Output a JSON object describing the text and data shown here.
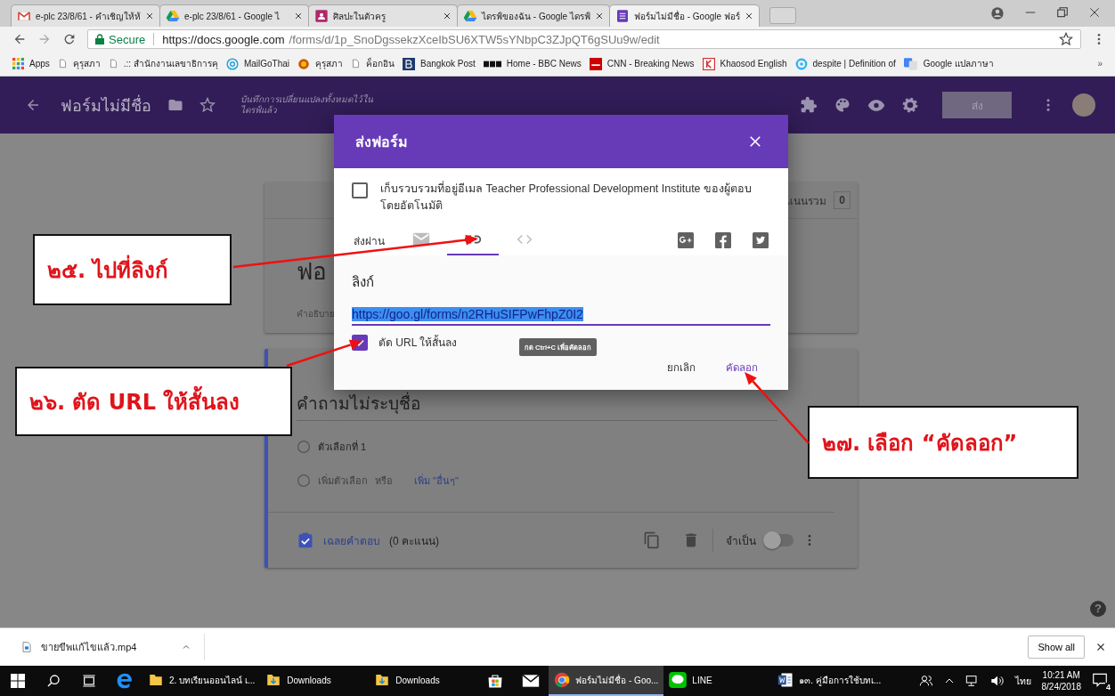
{
  "browser": {
    "tabs": [
      {
        "title": "e-plc 23/8/61 - คำเชิญให้ห้",
        "kind": "gmail",
        "selected": false
      },
      {
        "title": "e-plc 23/8/61 - Google ไ",
        "kind": "drive",
        "selected": false
      },
      {
        "title": "ศิลปะในตัวครู",
        "kind": "classroom",
        "selected": false
      },
      {
        "title": "ไดรฟ์ของฉัน - Google ไดรฟ์",
        "kind": "drive",
        "selected": false
      },
      {
        "title": "ฟอร์มไม่มีชื่อ - Google ฟอร์",
        "kind": "forms",
        "selected": true
      }
    ],
    "address": {
      "secure": "Secure",
      "host": "https://docs.google.com",
      "path": "/forms/d/1p_SnoDgssekzXceIbSU6XTW5sYNbpC3ZJpQT6gSUu9w/edit"
    },
    "bookmarks": [
      {
        "label": "Apps",
        "kind": "apps"
      },
      {
        "label": "คุรุสภา",
        "kind": "page"
      },
      {
        "label": ".:: สำนักงานเลขาธิการคุ",
        "kind": "page"
      },
      {
        "label": "MailGoThai",
        "kind": "at"
      },
      {
        "label": "คุรุสภา",
        "kind": "emblem"
      },
      {
        "label": "ค็อกอิน",
        "kind": "page"
      },
      {
        "label": "Bangkok Post",
        "kind": "letter-b"
      },
      {
        "label": "Home - BBC News",
        "kind": "blocks"
      },
      {
        "label": "CNN - Breaking News",
        "kind": "red"
      },
      {
        "label": "Khaosod English",
        "kind": "letter-k"
      },
      {
        "label": "despite | Definition of",
        "kind": "ring"
      },
      {
        "label": "Google แปลภาษา",
        "kind": "translate"
      }
    ],
    "bookmarks_more": "»"
  },
  "forms_header": {
    "title": "ฟอร์มไม่มีชื่อ",
    "save_note": "บันทึกการเปลี่ยนแปลงทั้งหมดไว้ในไดรฟ์แล้ว",
    "send_button": "ส่ง"
  },
  "form": {
    "points_label": "แนนรวม",
    "points_total": "0",
    "title": "ฟอ",
    "description": "คำอธิบาย",
    "question": "คำถามไม่ระบุชื่อ",
    "options": [
      "ตัวเลือกที่ 1"
    ],
    "add_option": "เพิ่มตัวเลือก",
    "or": "หรือ",
    "add_other": "เพิ่ม \"อื่นๆ\"",
    "answer_key": "เฉลยคำตอบ",
    "answer_points": "(0 คะแนน)",
    "required_label": "จำเป็น",
    "required": false,
    "help_button": "?"
  },
  "dialog": {
    "title": "ส่งฟอร์ม",
    "collect_emails": {
      "label": "เก็บรวบรวมที่อยู่อีเมล Teacher Professional Development Institute ของผู้ตอบโดยอัตโนมัติ",
      "checked": false
    },
    "send_via": "ส่งผ่าน",
    "methods": [
      {
        "kind": "email",
        "selected": false
      },
      {
        "kind": "link",
        "selected": true
      },
      {
        "kind": "embed",
        "selected": false
      }
    ],
    "share": [
      {
        "kind": "googleplus"
      },
      {
        "kind": "facebook"
      },
      {
        "kind": "twitter"
      }
    ],
    "link_heading": "ลิงก์",
    "link_url": "https://goo.gl/forms/n2RHuSIFPwFhpZ0I2",
    "url_highlighted": true,
    "shorten": {
      "label": "ตัด URL ให้สั้นลง",
      "checked": true
    },
    "tooltip": "กด Ctrl+C เพื่อคัดลอก",
    "buttons": [
      {
        "label": "ยกเลิก",
        "kind": "cancel"
      },
      {
        "label": "คัดลอก",
        "kind": "primary"
      }
    ]
  },
  "callouts": [
    {
      "text": "๒๕. ไปที่ลิงก์"
    },
    {
      "text": "๒๖. ตัด URL ให้สั้นลง"
    },
    {
      "text": "๒๗. เลือก “คัดลอก”"
    }
  ],
  "downloads": {
    "file": "ขายขีพแก้ไขแล้ว.mp4",
    "show_all": "Show all"
  },
  "taskbar": {
    "items": [
      {
        "label": "2. บทเรียนออนไลน์ เ...",
        "kind": "folder",
        "selected": false
      },
      {
        "label": "Downloads",
        "kind": "download-folder",
        "selected": false
      },
      {
        "label": "Downloads",
        "kind": "download-folder",
        "selected": false
      },
      {
        "label": "ฟอร์มไม่มีชื่อ - Goo...",
        "kind": "chrome",
        "selected": true
      },
      {
        "label": "LINE",
        "kind": "line",
        "selected": false
      },
      {
        "label": "๑๓. คู่มือการใช้บทเ...",
        "kind": "word",
        "selected": false
      }
    ],
    "language": "ไทย",
    "time": "10:21 AM",
    "date": "8/24/2018",
    "notifications": "4"
  }
}
